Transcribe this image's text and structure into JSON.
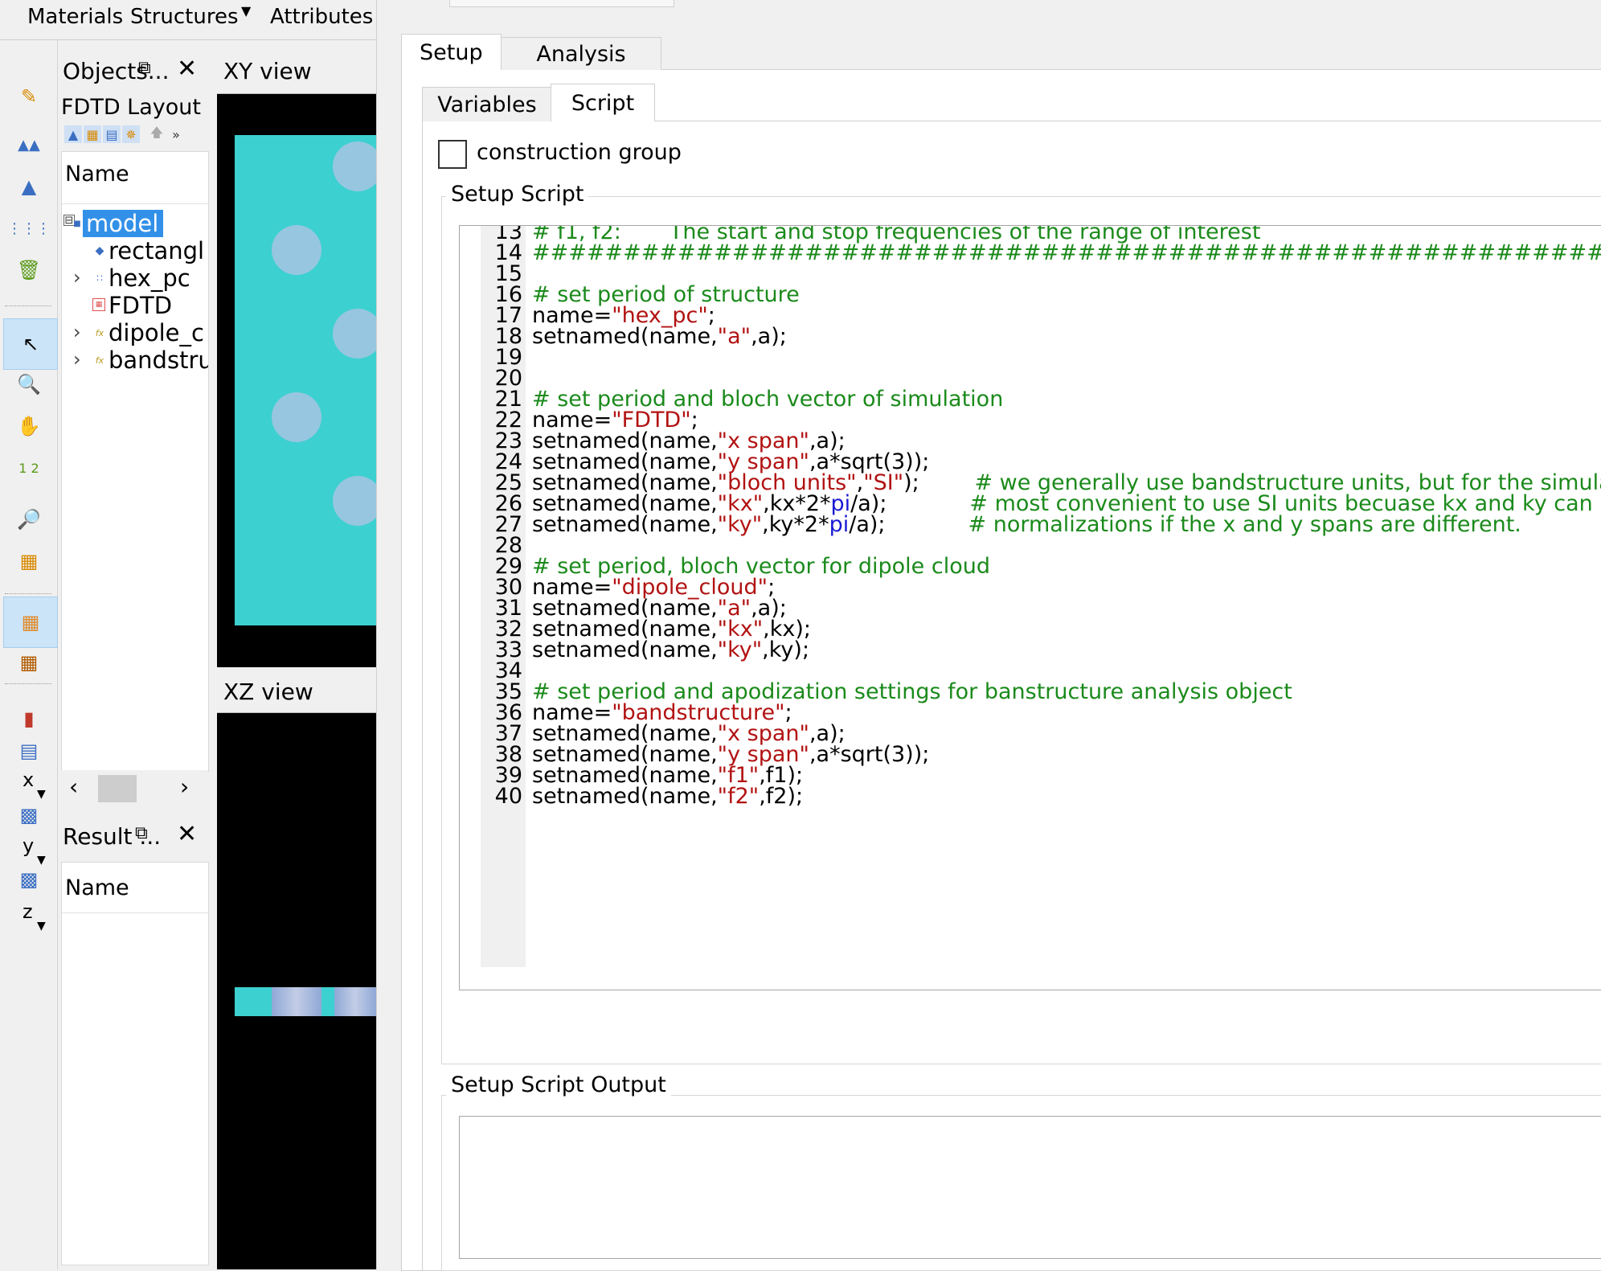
{
  "menu": {
    "materials": "Materials",
    "structures": "Structures",
    "attributes": "Attributes"
  },
  "toolbar": {
    "axis_x": "x",
    "axis_y": "y",
    "axis_z": "z",
    "icons": [
      "edit-icon",
      "mountains-icon",
      "pyramid-icon",
      "grid-dots-icon",
      "trash-icon",
      "pointer-icon",
      "zoom-icon",
      "pan-hand-icon",
      "ruler-icon",
      "zoom-extent-icon",
      "mesh-icon",
      "grid-view-icon",
      "calculator-icon"
    ]
  },
  "objects_panel": {
    "title": "Objects...",
    "layout_label": "FDTD Layout",
    "column_name": "Name",
    "items": [
      {
        "label": "model",
        "selected": true
      },
      {
        "label": "rectangl"
      },
      {
        "label": "hex_pc"
      },
      {
        "label": "FDTD"
      },
      {
        "label": "dipole_c"
      },
      {
        "label": "bandstru"
      }
    ]
  },
  "result_panel": {
    "title": "Result ...",
    "column_name": "Name"
  },
  "views": {
    "xy_title": "XY view",
    "xz_title": "XZ view"
  },
  "main": {
    "outer_tabs": [
      "Setup",
      "Analysis"
    ],
    "inner_tabs": [
      "Variables",
      "Script"
    ],
    "construction_group_label": "construction group",
    "setup_script_title": "Setup Script",
    "setup_script_output_title": "Setup Script Output"
  },
  "code": {
    "partial_first_line": "# f1, f2:       The start and stop frequencies of the range of interest",
    "lines": [
      {
        "n": "14",
        "segments": [
          {
            "t": "#################################################################",
            "c": "comment"
          }
        ]
      },
      {
        "n": "15",
        "segments": []
      },
      {
        "n": "16",
        "segments": [
          {
            "t": "# set period of structure",
            "c": "comment"
          }
        ]
      },
      {
        "n": "17",
        "segments": [
          {
            "t": "name=",
            "c": "plain"
          },
          {
            "t": "\"hex_pc\"",
            "c": "string"
          },
          {
            "t": ";",
            "c": "plain"
          }
        ]
      },
      {
        "n": "18",
        "segments": [
          {
            "t": "setnamed(name,",
            "c": "plain"
          },
          {
            "t": "\"a\"",
            "c": "string"
          },
          {
            "t": ",a);",
            "c": "plain"
          }
        ]
      },
      {
        "n": "19",
        "segments": []
      },
      {
        "n": "20",
        "segments": []
      },
      {
        "n": "21",
        "segments": [
          {
            "t": "# set period and bloch vector of simulation",
            "c": "comment"
          }
        ]
      },
      {
        "n": "22",
        "segments": [
          {
            "t": "name=",
            "c": "plain"
          },
          {
            "t": "\"FDTD\"",
            "c": "string"
          },
          {
            "t": ";",
            "c": "plain"
          }
        ]
      },
      {
        "n": "23",
        "segments": [
          {
            "t": "setnamed(name,",
            "c": "plain"
          },
          {
            "t": "\"x span\"",
            "c": "string"
          },
          {
            "t": ",a);",
            "c": "plain"
          }
        ]
      },
      {
        "n": "24",
        "segments": [
          {
            "t": "setnamed(name,",
            "c": "plain"
          },
          {
            "t": "\"y span\"",
            "c": "string"
          },
          {
            "t": ",a*sqrt(3));",
            "c": "plain"
          }
        ]
      },
      {
        "n": "25",
        "segments": [
          {
            "t": "setnamed(name,",
            "c": "plain"
          },
          {
            "t": "\"bloch units\"",
            "c": "string"
          },
          {
            "t": ",",
            "c": "plain"
          },
          {
            "t": "\"SI\"",
            "c": "string"
          },
          {
            "t": ");        ",
            "c": "plain"
          },
          {
            "t": "# we generally use bandstructure units, but for the simulation region, it is",
            "c": "comment"
          }
        ]
      },
      {
        "n": "26",
        "segments": [
          {
            "t": "setnamed(name,",
            "c": "plain"
          },
          {
            "t": "\"kx\"",
            "c": "string"
          },
          {
            "t": ",kx*2*",
            "c": "plain"
          },
          {
            "t": "pi",
            "c": "keyword"
          },
          {
            "t": "/a);            ",
            "c": "plain"
          },
          {
            "t": "# most convenient to use SI units becuase kx and ky can have different",
            "c": "comment"
          }
        ]
      },
      {
        "n": "27",
        "segments": [
          {
            "t": "setnamed(name,",
            "c": "plain"
          },
          {
            "t": "\"ky\"",
            "c": "string"
          },
          {
            "t": ",ky*2*",
            "c": "plain"
          },
          {
            "t": "pi",
            "c": "keyword"
          },
          {
            "t": "/a);            ",
            "c": "plain"
          },
          {
            "t": "# normalizations if the x and y spans are different.",
            "c": "comment"
          }
        ]
      },
      {
        "n": "28",
        "segments": []
      },
      {
        "n": "29",
        "segments": [
          {
            "t": "# set period, bloch vector for dipole cloud",
            "c": "comment"
          }
        ]
      },
      {
        "n": "30",
        "segments": [
          {
            "t": "name=",
            "c": "plain"
          },
          {
            "t": "\"dipole_cloud\"",
            "c": "string"
          },
          {
            "t": ";",
            "c": "plain"
          }
        ]
      },
      {
        "n": "31",
        "segments": [
          {
            "t": "setnamed(name,",
            "c": "plain"
          },
          {
            "t": "\"a\"",
            "c": "string"
          },
          {
            "t": ",a);",
            "c": "plain"
          }
        ]
      },
      {
        "n": "32",
        "segments": [
          {
            "t": "setnamed(name,",
            "c": "plain"
          },
          {
            "t": "\"kx\"",
            "c": "string"
          },
          {
            "t": ",kx);",
            "c": "plain"
          }
        ]
      },
      {
        "n": "33",
        "segments": [
          {
            "t": "setnamed(name,",
            "c": "plain"
          },
          {
            "t": "\"ky\"",
            "c": "string"
          },
          {
            "t": ",ky);",
            "c": "plain"
          }
        ]
      },
      {
        "n": "34",
        "segments": []
      },
      {
        "n": "35",
        "segments": [
          {
            "t": "# set period and apodization settings for banstructure analysis object",
            "c": "comment"
          }
        ]
      },
      {
        "n": "36",
        "segments": [
          {
            "t": "name=",
            "c": "plain"
          },
          {
            "t": "\"bandstructure\"",
            "c": "string"
          },
          {
            "t": ";",
            "c": "plain"
          }
        ]
      },
      {
        "n": "37",
        "segments": [
          {
            "t": "setnamed(name,",
            "c": "plain"
          },
          {
            "t": "\"x span\"",
            "c": "string"
          },
          {
            "t": ",a);",
            "c": "plain"
          }
        ]
      },
      {
        "n": "38",
        "segments": [
          {
            "t": "setnamed(name,",
            "c": "plain"
          },
          {
            "t": "\"y span\"",
            "c": "string"
          },
          {
            "t": ",a*sqrt(3));",
            "c": "plain"
          }
        ]
      },
      {
        "n": "39",
        "segments": [
          {
            "t": "setnamed(name,",
            "c": "plain"
          },
          {
            "t": "\"f1\"",
            "c": "string"
          },
          {
            "t": ",f1);",
            "c": "plain"
          }
        ]
      },
      {
        "n": "40",
        "segments": [
          {
            "t": "setnamed(name,",
            "c": "plain"
          },
          {
            "t": "\"f2\"",
            "c": "string"
          },
          {
            "t": ",f2);",
            "c": "plain"
          }
        ]
      }
    ]
  }
}
